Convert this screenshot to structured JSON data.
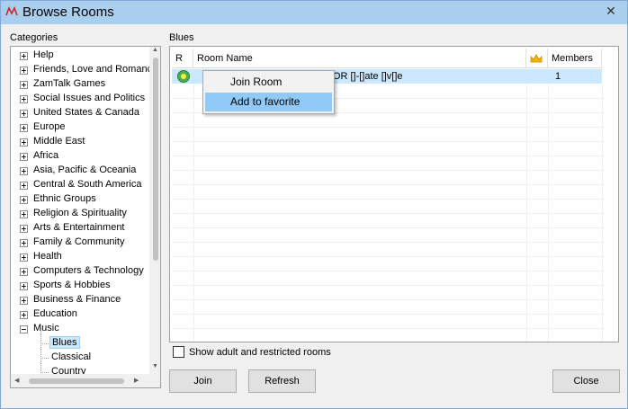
{
  "window": {
    "title": "Browse Rooms",
    "close_glyph": "✕"
  },
  "categories": {
    "label": "Categories",
    "items": [
      {
        "label": "Help",
        "expanded": false
      },
      {
        "label": "Friends, Love and Romance",
        "expanded": false
      },
      {
        "label": "ZamTalk Games",
        "expanded": false
      },
      {
        "label": "Social Issues and Politics",
        "expanded": false
      },
      {
        "label": "United States & Canada",
        "expanded": false
      },
      {
        "label": "Europe",
        "expanded": false
      },
      {
        "label": "Middle East",
        "expanded": false
      },
      {
        "label": "Africa",
        "expanded": false
      },
      {
        "label": "Asia, Pacific & Oceania",
        "expanded": false
      },
      {
        "label": "Central & South America",
        "expanded": false
      },
      {
        "label": "Ethnic Groups",
        "expanded": false
      },
      {
        "label": "Religion & Spirituality",
        "expanded": false
      },
      {
        "label": "Arts & Entertainment",
        "expanded": false
      },
      {
        "label": "Family & Community",
        "expanded": false
      },
      {
        "label": "Health",
        "expanded": false
      },
      {
        "label": "Computers & Technology",
        "expanded": false
      },
      {
        "label": "Sports & Hobbies",
        "expanded": false
      },
      {
        "label": "Business & Finance",
        "expanded": false
      },
      {
        "label": "Education",
        "expanded": false
      },
      {
        "label": "Music",
        "expanded": true
      }
    ],
    "music_children": [
      "Blues",
      "Classical",
      "Country"
    ],
    "selected": "Blues"
  },
  "rooms": {
    "label": "Blues",
    "columns": {
      "r": "R",
      "name": "Room Name",
      "owner_icon": "crown-icon",
      "members": "Members"
    },
    "rows": [
      {
        "name": "[]v[]e  OR  []-[]ate  []v[]e",
        "members": "1"
      }
    ]
  },
  "context_menu": {
    "items": [
      "Join Room",
      "Add to favorite"
    ],
    "highlighted": "Add to favorite"
  },
  "options": {
    "show_adult_label": "Show adult and restricted rooms",
    "show_adult_checked": false
  },
  "buttons": {
    "join": "Join",
    "refresh": "Refresh",
    "close": "Close"
  },
  "colors": {
    "titlebar": "#aacfee",
    "selection": "#cce8ff",
    "menu_highlight": "#91c9f7"
  }
}
